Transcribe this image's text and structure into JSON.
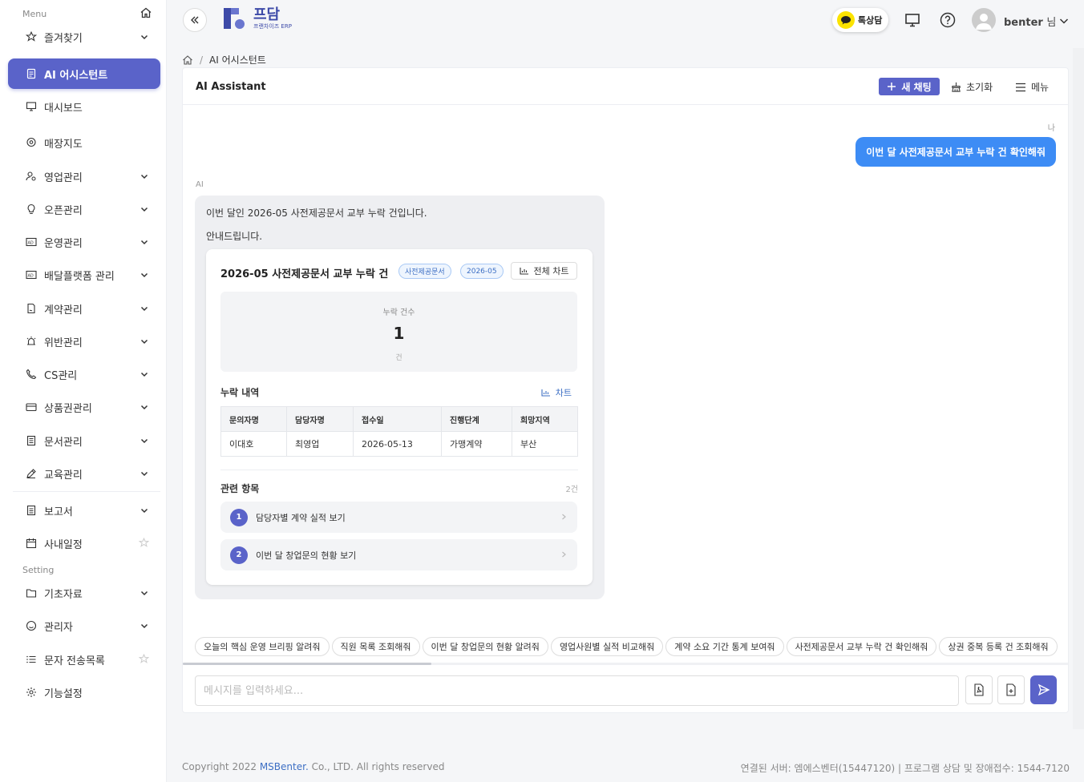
{
  "sidebar": {
    "menu_label": "Menu",
    "setting_label": "Setting",
    "items": [
      {
        "label": "즐겨찾기"
      },
      {
        "label": "AI 어시스턴트"
      },
      {
        "label": "대시보드"
      },
      {
        "label": "매장지도"
      },
      {
        "label": "영업관리"
      },
      {
        "label": "오픈관리"
      },
      {
        "label": "운영관리"
      },
      {
        "label": "배달플랫폼 관리"
      },
      {
        "label": "계약관리"
      },
      {
        "label": "위반관리"
      },
      {
        "label": "CS관리"
      },
      {
        "label": "상품권관리"
      },
      {
        "label": "문서관리"
      },
      {
        "label": "교육관리"
      },
      {
        "label": "보고서"
      },
      {
        "label": "사내일정"
      },
      {
        "label": "기초자료"
      },
      {
        "label": "관리자"
      },
      {
        "label": "문자 전송목록"
      },
      {
        "label": "기능설정"
      }
    ]
  },
  "topbar": {
    "logo_main": "프담",
    "logo_sub": "프랜차이즈 ERP",
    "talk_label": "톡상담",
    "username": "benter",
    "username_suffix": "님"
  },
  "breadcrumb": {
    "current": "AI 어시스턴트"
  },
  "panel": {
    "title": "AI Assistant",
    "new_chat": "새 채팅",
    "reset": "초기화",
    "menu": "메뉴"
  },
  "chat": {
    "me_label": "나",
    "user_message": "이번 달 사전제공문서 교부 누락 건 확인해줘",
    "ai_label": "AI",
    "ai_line1": "이번 달인 2026-05 사전제공문서 교부 누락 건입니다.",
    "ai_line2": "안내드립니다."
  },
  "card": {
    "title": "2026-05 사전제공문서 교부 누락 건",
    "tag1": "사전제공문서",
    "tag2": "2026-05",
    "full_chart": "전체 차트",
    "stat_label": "누락 건수",
    "stat_value": "1",
    "stat_unit": "건",
    "detail_title": "누락 내역",
    "detail_chart": "차트",
    "table": {
      "headers": [
        "문의자명",
        "담당자명",
        "접수일",
        "진행단계",
        "희망지역"
      ],
      "rows": [
        [
          "이대호",
          "최영업",
          "2026-05-13",
          "가맹계약",
          "부산"
        ]
      ]
    },
    "related_title": "관련 항목",
    "related_count": "2건",
    "related": [
      {
        "num": "1",
        "label": "담당자별 계약 실적 보기"
      },
      {
        "num": "2",
        "label": "이번 달 창업문의 현황 보기"
      }
    ]
  },
  "chips": [
    "오늘의 핵심 운영 브리핑 알려줘",
    "직원 목록 조회해줘",
    "이번 달 창업문의 현황 알려줘",
    "영업사원별 실적 비교해줘",
    "계약 소요 기간 통계 보여줘",
    "사전제공문서 교부 누락 건 확인해줘",
    "상권 중복 등록 건 조회해줘"
  ],
  "input": {
    "placeholder": "메시지를 입력하세요..."
  },
  "footer": {
    "left_prefix": "Copyright 2022",
    "left_brand": "MSBenter.",
    "left_suffix": "Co., LTD. All rights reserved",
    "right": "연결된 서버: 엠에스벤터(15447120) | 프로그램 상담 및 장애접수: 1544-7120"
  }
}
